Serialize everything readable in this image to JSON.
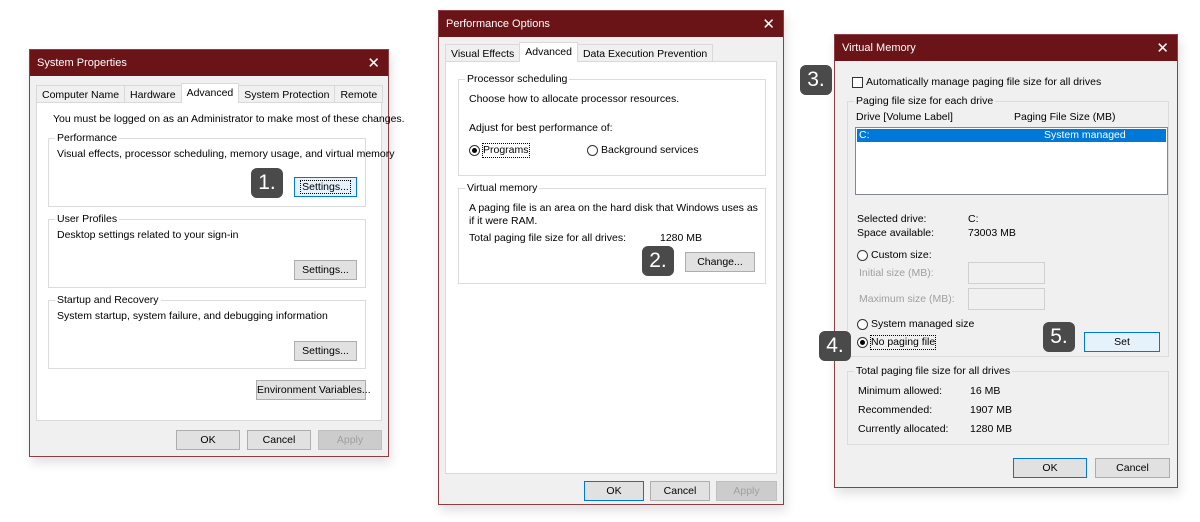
{
  "colors": {
    "titlebar": "#6b1418",
    "accent": "#0078d7",
    "badge": "#4a4a4a"
  },
  "system_properties": {
    "title": "System Properties",
    "close_icon": "close-icon",
    "tabs": [
      {
        "label": "Computer Name",
        "active": false
      },
      {
        "label": "Hardware",
        "active": false
      },
      {
        "label": "Advanced",
        "active": true
      },
      {
        "label": "System Protection",
        "active": false
      },
      {
        "label": "Remote",
        "active": false
      }
    ],
    "admin_notice": "You must be logged on as an Administrator to make most of these changes.",
    "performance": {
      "label": "Performance",
      "description": "Visual effects, processor scheduling, memory usage, and virtual memory",
      "settings_button": "Settings..."
    },
    "user_profiles": {
      "label": "User Profiles",
      "description": "Desktop settings related to your sign-in",
      "settings_button": "Settings..."
    },
    "startup_recovery": {
      "label": "Startup and Recovery",
      "description": "System startup, system failure, and debugging information",
      "settings_button": "Settings..."
    },
    "env_vars_button": "Environment Variables...",
    "ok_button": "OK",
    "cancel_button": "Cancel",
    "apply_button": "Apply"
  },
  "performance_options": {
    "title": "Performance Options",
    "tabs": [
      {
        "label": "Visual Effects",
        "active": false
      },
      {
        "label": "Advanced",
        "active": true
      },
      {
        "label": "Data Execution Prevention",
        "active": false
      }
    ],
    "processor_scheduling": {
      "label": "Processor scheduling",
      "description": "Choose how to allocate processor resources.",
      "adjust_label": "Adjust for best performance of:",
      "options": [
        {
          "label": "Programs",
          "checked": true
        },
        {
          "label": "Background services",
          "checked": false
        }
      ]
    },
    "virtual_memory": {
      "label": "Virtual memory",
      "description": "A paging file is an area on the hard disk that Windows uses as if it were RAM.",
      "total_label": "Total paging file size for all drives:",
      "total_value": "1280 MB",
      "change_button": "Change..."
    },
    "ok_button": "OK",
    "cancel_button": "Cancel",
    "apply_button": "Apply"
  },
  "virtual_memory": {
    "title": "Virtual Memory",
    "auto_manage_label": "Automatically manage paging file size for all drives",
    "auto_manage_checked": false,
    "paging_group_label": "Paging file size for each drive",
    "columns": {
      "drive": "Drive  [Volume Label]",
      "size": "Paging File Size (MB)"
    },
    "drives": [
      {
        "drive": "C:",
        "size": "System managed",
        "selected": true
      }
    ],
    "selected_drive_label": "Selected drive:",
    "selected_drive_value": "C:",
    "space_available_label": "Space available:",
    "space_available_value": "73003 MB",
    "custom_size_label": "Custom size:",
    "initial_size_label": "Initial size (MB):",
    "initial_size_value": "",
    "maximum_size_label": "Maximum size (MB):",
    "maximum_size_value": "",
    "system_managed_label": "System managed size",
    "no_paging_label": "No paging file",
    "selected_option": "No paging file",
    "set_button": "Set",
    "totals": {
      "label": "Total paging file size for all drives",
      "minimum_label": "Minimum allowed:",
      "minimum_value": "16 MB",
      "recommended_label": "Recommended:",
      "recommended_value": "1907 MB",
      "current_label": "Currently allocated:",
      "current_value": "1280 MB"
    },
    "ok_button": "OK",
    "cancel_button": "Cancel"
  },
  "steps": [
    "1.",
    "2.",
    "3.",
    "4.",
    "5."
  ]
}
